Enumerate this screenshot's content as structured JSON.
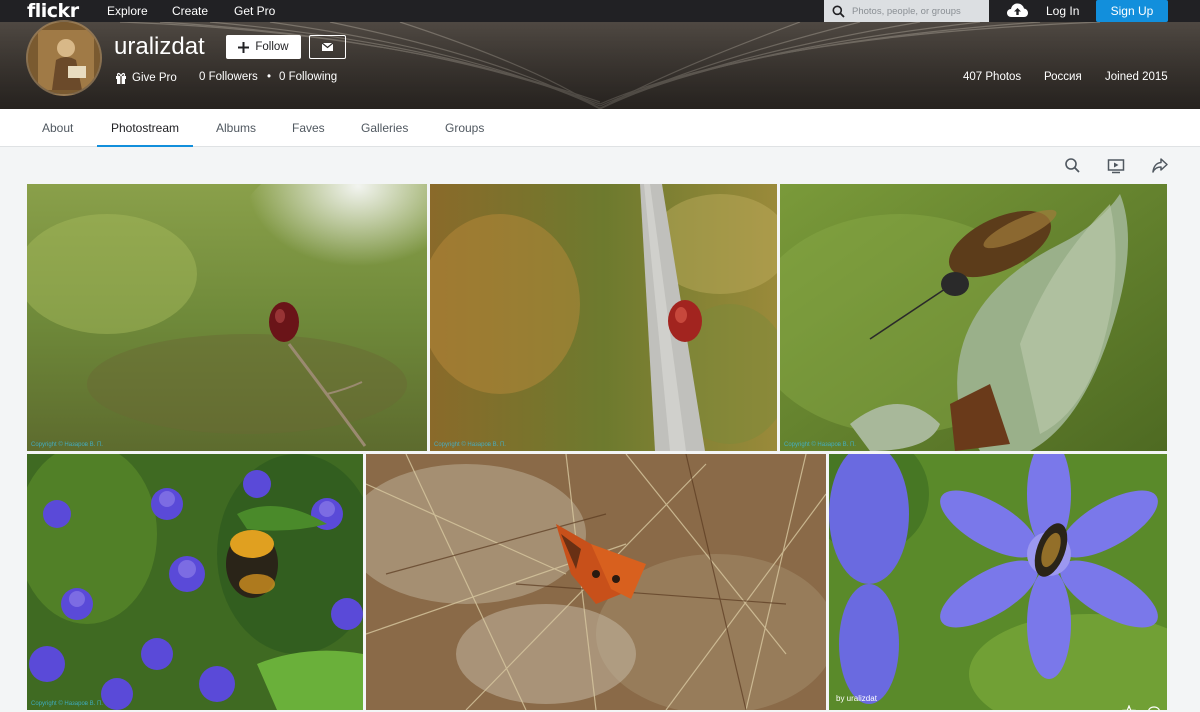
{
  "topnav": {
    "logo": "flickr",
    "links": [
      "Explore",
      "Create",
      "Get Pro"
    ],
    "search_placeholder": "Photos, people, or groups",
    "upload_icon": "cloud-upload-icon",
    "login": "Log In",
    "signup": "Sign Up"
  },
  "profile": {
    "username": "uralizdat",
    "follow_label": "Follow",
    "give_pro": "Give Pro",
    "followers": "0 Followers",
    "separator": "•",
    "following": "0 Following",
    "photos_count": "407 Photos",
    "location": "Россия",
    "joined": "Joined 2015"
  },
  "tabs": [
    {
      "label": "About",
      "active": false
    },
    {
      "label": "Photostream",
      "active": true
    },
    {
      "label": "Albums",
      "active": false
    },
    {
      "label": "Faves",
      "active": false
    },
    {
      "label": "Galleries",
      "active": false
    },
    {
      "label": "Groups",
      "active": false
    }
  ],
  "toolbar_icons": [
    "search-icon",
    "slideshow-icon",
    "share-icon"
  ],
  "photos": [
    {
      "subject": "red beetle on twig",
      "watermark": "Copyright © Назаров В. П."
    },
    {
      "subject": "red beetle on branch",
      "watermark": "Copyright © Назаров В. П."
    },
    {
      "subject": "beetle on bud",
      "watermark": "Copyright © Назаров В. П."
    },
    {
      "subject": "bumblebee on blue flowers",
      "watermark": "Copyright © Назаров В. П."
    },
    {
      "subject": "butterfly on pine needles",
      "watermark": ""
    },
    {
      "subject": "hoverfly on chicory",
      "byline": "by uralizdat"
    }
  ],
  "colors": {
    "accent": "#128fdc",
    "topnav_bg": "#212124",
    "page_bg": "#f3f5f6"
  }
}
